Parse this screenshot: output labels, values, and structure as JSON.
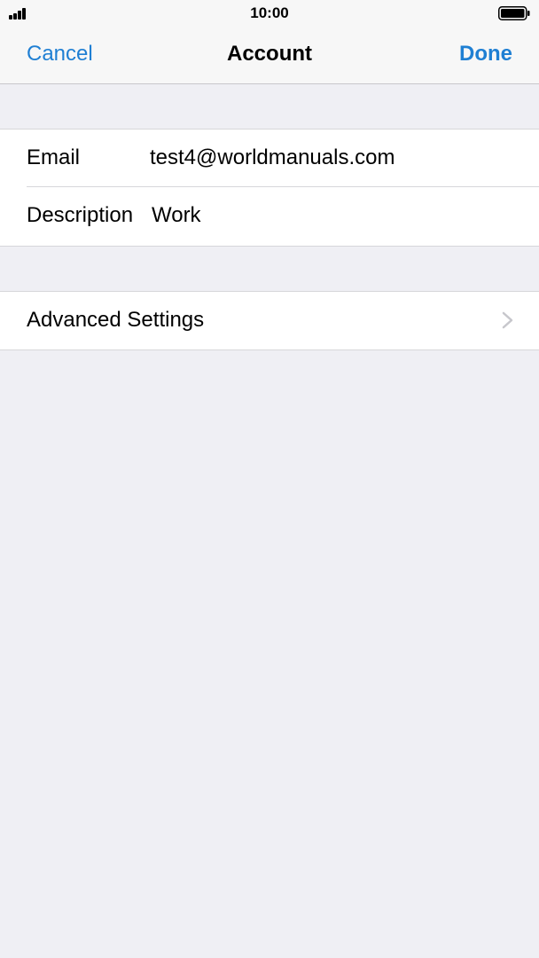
{
  "status_bar": {
    "time": "10:00",
    "signal_icon": "signal-bars-icon",
    "battery_icon": "battery-full-icon"
  },
  "nav": {
    "cancel_label": "Cancel",
    "title": "Account",
    "done_label": "Done"
  },
  "account": {
    "email_label": "Email",
    "email_value": "test4@worldmanuals.com",
    "description_label": "Description",
    "description_value": "Work"
  },
  "advanced": {
    "label": "Advanced Settings",
    "chevron_icon": "chevron-right-icon"
  },
  "colors": {
    "accent": "#1f7fd3",
    "background": "#efeff4",
    "bar": "#f7f7f7",
    "separator": "#d6d6da"
  }
}
